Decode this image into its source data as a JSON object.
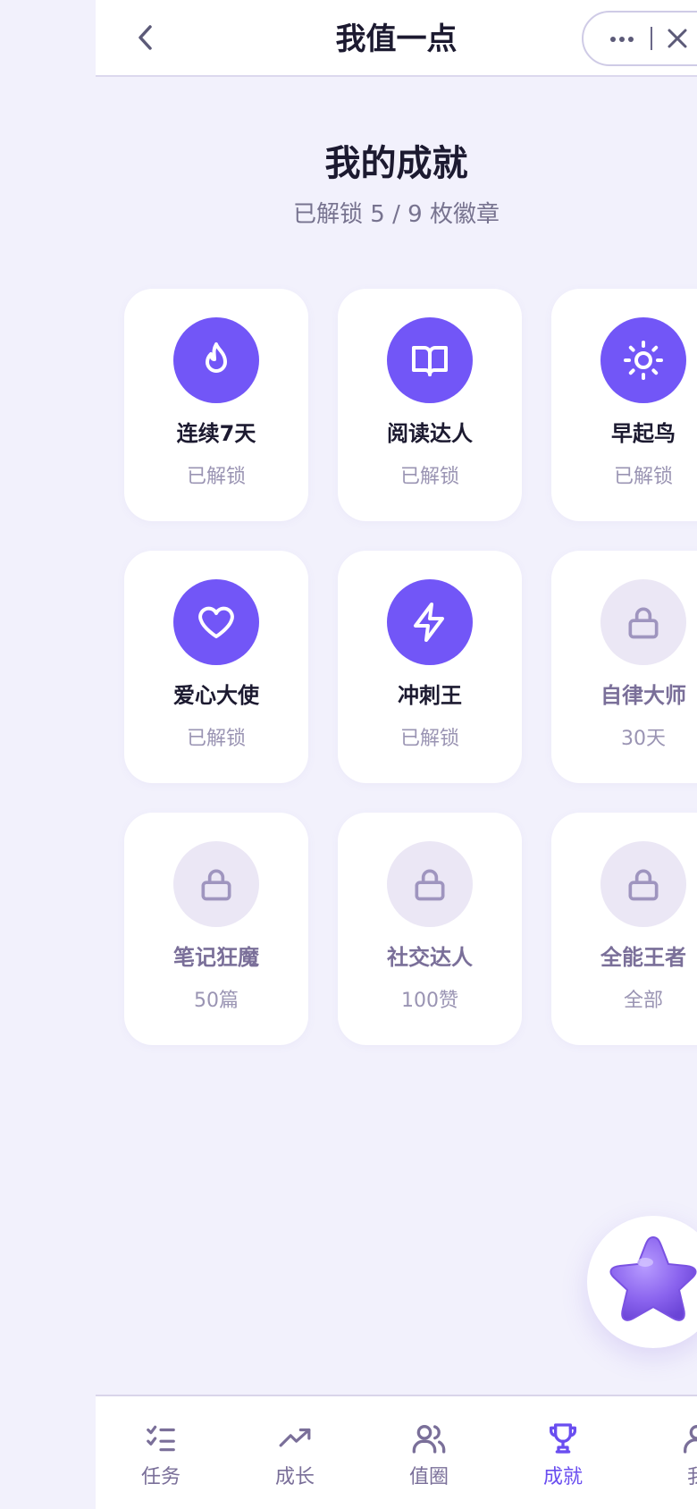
{
  "header": {
    "title": "我值一点"
  },
  "achievements": {
    "title": "我的成就",
    "summary": "已解锁 5 / 9 枚徽章",
    "badges": [
      {
        "name": "连续7天",
        "status": "已解锁",
        "icon": "flame-icon",
        "unlocked": true
      },
      {
        "name": "阅读达人",
        "status": "已解锁",
        "icon": "book-icon",
        "unlocked": true
      },
      {
        "name": "早起鸟",
        "status": "已解锁",
        "icon": "sun-icon",
        "unlocked": true
      },
      {
        "name": "爱心大使",
        "status": "已解锁",
        "icon": "heart-icon",
        "unlocked": true
      },
      {
        "name": "冲刺王",
        "status": "已解锁",
        "icon": "lightning-icon",
        "unlocked": true
      },
      {
        "name": "自律大师",
        "status": "30天",
        "icon": "lock-icon",
        "unlocked": false
      },
      {
        "name": "笔记狂魔",
        "status": "50篇",
        "icon": "lock-icon",
        "unlocked": false
      },
      {
        "name": "社交达人",
        "status": "100赞",
        "icon": "lock-icon",
        "unlocked": false
      },
      {
        "name": "全能王者",
        "status": "全部",
        "icon": "lock-icon",
        "unlocked": false
      }
    ]
  },
  "tabbar": {
    "tabs": [
      {
        "label": "任务",
        "icon": "checklist-icon",
        "active": false
      },
      {
        "label": "成长",
        "icon": "trending-up-icon",
        "active": false
      },
      {
        "label": "值圈",
        "icon": "users-icon",
        "active": false
      },
      {
        "label": "成就",
        "icon": "trophy-icon",
        "active": true
      },
      {
        "label": "我",
        "icon": "user-icon",
        "active": false
      }
    ]
  },
  "colors": {
    "accent": "#7256f7",
    "active_tab": "#6a4ef0",
    "page_background": "#f2f1fc",
    "locked_circle": "#ebe7f5",
    "muted_text": "#9a94b3"
  }
}
